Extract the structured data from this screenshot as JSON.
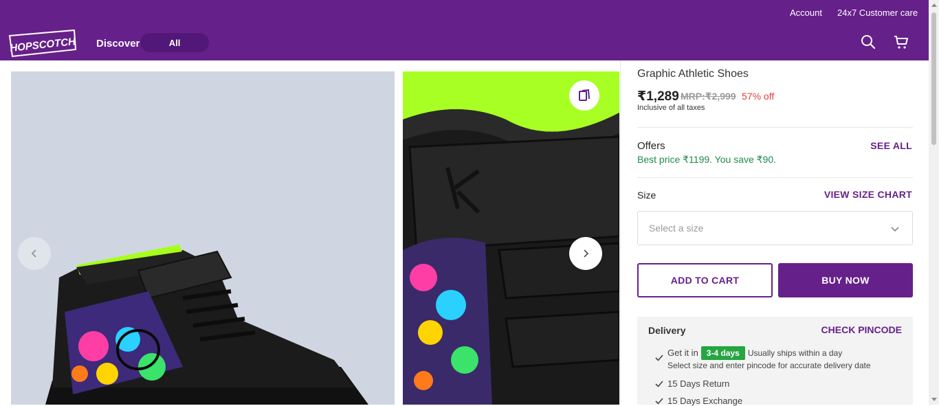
{
  "header": {
    "account_label": "Account",
    "customer_care_label": "24x7 Customer care",
    "logo_text": "HOPSCOTCH",
    "discover_label": "Discover",
    "all_label": "All",
    "brand_color": "#66208a",
    "icons": [
      "search-icon",
      "cart-icon"
    ]
  },
  "gallery": {
    "icons": [
      "chevron-left-icon",
      "chevron-right-icon",
      "similar-products-icon"
    ]
  },
  "product": {
    "title": "Graphic Athletic Shoes",
    "price": "₹1,289",
    "mrp": "MRP:₹2,999",
    "discount": "57% off",
    "taxes_note": "Inclusive of all taxes"
  },
  "offers": {
    "title": "Offers",
    "see_all": "SEE ALL",
    "best_price": "Best price ₹1199. You save ₹90."
  },
  "size": {
    "title": "Size",
    "size_chart_link": "VIEW SIZE CHART",
    "placeholder": "Select a size"
  },
  "actions": {
    "add_to_cart": "ADD TO CART",
    "buy_now": "BUY NOW"
  },
  "delivery": {
    "title": "Delivery",
    "check_pincode": "CHECK PINCODE",
    "get_it_in": "Get it in",
    "days_badge": "3-4 days",
    "ships_note": "Usually ships within a day",
    "pincode_note": "Select size and enter pincode for accurate delivery date",
    "return_policy": "15 Days Return",
    "exchange_policy": "15 Days Exchange"
  }
}
